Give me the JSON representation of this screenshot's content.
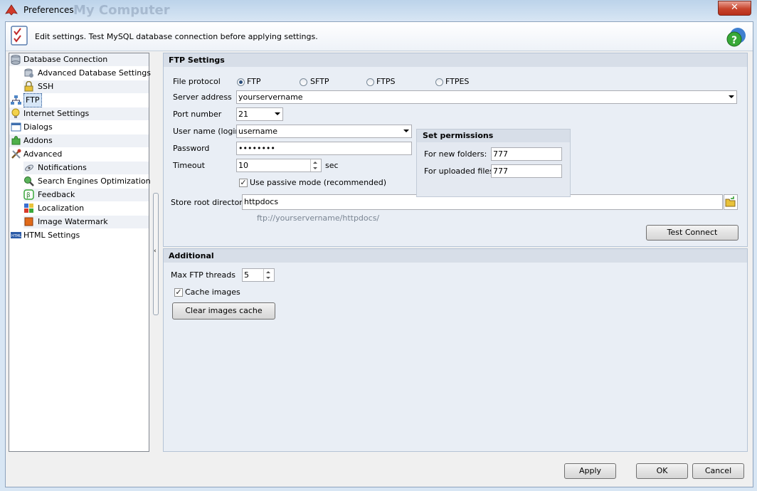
{
  "window": {
    "title": "Preferences",
    "ghost_title": "My Computer",
    "close_label": "✕"
  },
  "header": {
    "text": "Edit settings. Test MySQL database connection before applying settings."
  },
  "tree": {
    "items": [
      {
        "label": "Database Connection"
      },
      {
        "label": "Advanced Database Settings"
      },
      {
        "label": "SSH"
      },
      {
        "label": "FTP"
      },
      {
        "label": "Internet Settings"
      },
      {
        "label": "Dialogs"
      },
      {
        "label": "Addons"
      },
      {
        "label": "Advanced"
      },
      {
        "label": "Notifications"
      },
      {
        "label": "Search Engines Optimization"
      },
      {
        "label": "Feedback"
      },
      {
        "label": "Localization"
      },
      {
        "label": "Image Watermark"
      },
      {
        "label": "HTML Settings"
      }
    ]
  },
  "ftp": {
    "title": "FTP Settings",
    "protocol_label": "File protocol",
    "protocols": [
      "FTP",
      "SFTP",
      "FTPS",
      "FTPES"
    ],
    "selected_protocol": "FTP",
    "server_label": "Server address",
    "server_value": "yourservername",
    "port_label": "Port number",
    "port_value": "21",
    "user_label": "User name (login)",
    "user_value": "username",
    "password_label": "Password",
    "password_value": "••••••••",
    "timeout_label": "Timeout",
    "timeout_value": "10",
    "timeout_unit": "sec",
    "passive_label": "Use passive mode (recommended)",
    "passive_checked": true,
    "store_root_label": "Store root directory",
    "store_root_value": "httpdocs",
    "ftp_url": "ftp://yourservername/httpdocs/",
    "test_button": "Test Connect"
  },
  "permissions": {
    "title": "Set permissions",
    "folders_label": "For new folders:",
    "folders_value": "777",
    "files_label": "For uploaded files:",
    "files_value": "777"
  },
  "additional": {
    "title": "Additional",
    "threads_label": "Max FTP threads",
    "threads_value": "5",
    "cache_label": "Cache images",
    "cache_checked": true,
    "clear_button": "Clear images cache"
  },
  "footer": {
    "apply": "Apply",
    "ok": "OK",
    "cancel": "Cancel"
  }
}
